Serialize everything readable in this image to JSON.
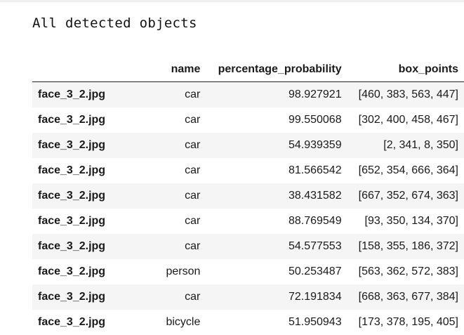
{
  "title": "All detected objects",
  "table": {
    "columns": [
      "",
      "name",
      "percentage_probability",
      "box_points"
    ],
    "rows": [
      {
        "index": "face_3_2.jpg",
        "name": "car",
        "percentage_probability": "98.927921",
        "box_points": "[460, 383, 563, 447]"
      },
      {
        "index": "face_3_2.jpg",
        "name": "car",
        "percentage_probability": "99.550068",
        "box_points": "[302, 400, 458, 467]"
      },
      {
        "index": "face_3_2.jpg",
        "name": "car",
        "percentage_probability": "54.939359",
        "box_points": "[2, 341, 8, 350]"
      },
      {
        "index": "face_3_2.jpg",
        "name": "car",
        "percentage_probability": "81.566542",
        "box_points": "[652, 354, 666, 364]"
      },
      {
        "index": "face_3_2.jpg",
        "name": "car",
        "percentage_probability": "38.431582",
        "box_points": "[667, 352, 674, 363]"
      },
      {
        "index": "face_3_2.jpg",
        "name": "car",
        "percentage_probability": "88.769549",
        "box_points": "[93, 350, 134, 370]"
      },
      {
        "index": "face_3_2.jpg",
        "name": "car",
        "percentage_probability": "54.577553",
        "box_points": "[158, 355, 186, 372]"
      },
      {
        "index": "face_3_2.jpg",
        "name": "person",
        "percentage_probability": "50.253487",
        "box_points": "[563, 362, 572, 383]"
      },
      {
        "index": "face_3_2.jpg",
        "name": "car",
        "percentage_probability": "72.191834",
        "box_points": "[668, 363, 677, 384]"
      },
      {
        "index": "face_3_2.jpg",
        "name": "bicycle",
        "percentage_probability": "51.950943",
        "box_points": "[173, 378, 195, 405]"
      }
    ]
  }
}
